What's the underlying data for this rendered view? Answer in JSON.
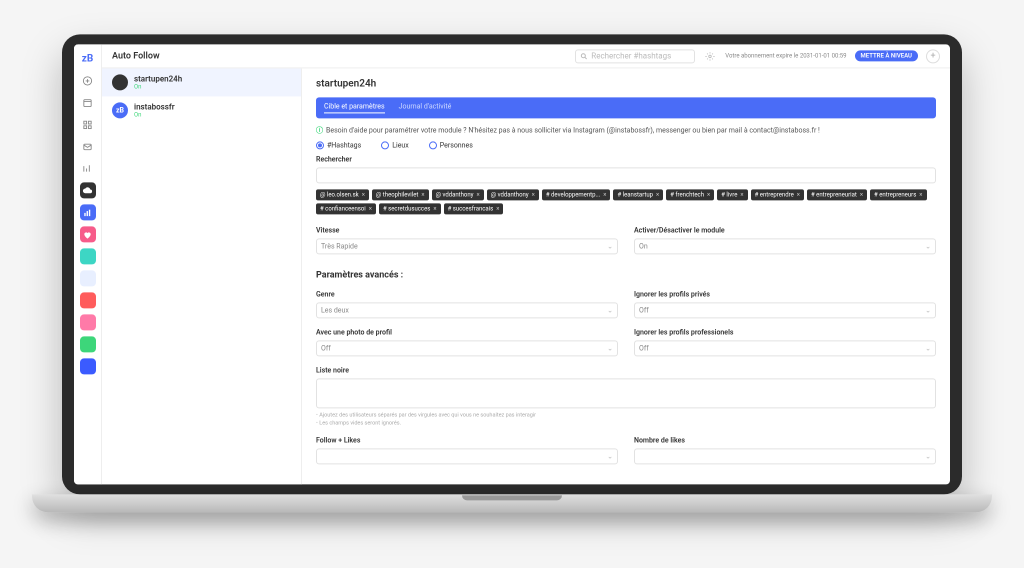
{
  "app": {
    "title": "Auto Follow"
  },
  "topbar": {
    "search_placeholder": "Rechercher #hashtags",
    "expire": "Votre abonnement expire le 2031-01-01 00:59",
    "upgrade": "METTRE À NIVEAU"
  },
  "accounts": [
    {
      "name": "startupen24h",
      "status": "On"
    },
    {
      "name": "instabossfr",
      "status": "On"
    }
  ],
  "panel": {
    "title": "startupen24h",
    "tabs": {
      "targets": "Cible et paramètres",
      "journal": "Journal d'activité"
    },
    "help": "Besoin d'aide pour paramétrer votre module ? N'hésitez pas à nous solliciter via Instagram (@instabossfr), messenger ou bien par mail à contact@instaboss.fr !",
    "radios": {
      "hashtags": "#Hashtags",
      "lieux": "Lieux",
      "personnes": "Personnes"
    },
    "search_label": "Rechercher",
    "tags": [
      "@ leo.olsen.sk",
      "@ theophilevilet",
      "@ vddanthony",
      "@ vddanthony",
      "# developpementp...",
      "# leanstartup",
      "# frenchtech",
      "# livre",
      "# entreprendre",
      "# entrepreneuriat",
      "# entrepreneurs",
      "# confianceensoi",
      "# secretdusucces",
      "# succesfrancais"
    ],
    "vitesse": {
      "label": "Vitesse",
      "value": "Très Rapide"
    },
    "activer": {
      "label": "Activer/Désactiver le module",
      "value": "On"
    },
    "advanced": {
      "heading": "Paramètres avancés :",
      "genre": {
        "label": "Genre",
        "value": "Les deux"
      },
      "ignore_private": {
        "label": "Ignorer les profils privés",
        "value": "Off"
      },
      "photo": {
        "label": "Avec une photo de profil",
        "value": "Off"
      },
      "ignore_pro": {
        "label": "Ignorer les profils professionels",
        "value": "Off"
      },
      "blacklist_label": "Liste noire",
      "hint1": "Ajoutez des utilisateurs séparés par des virgules avec qui vous ne souhaitez pas interagir",
      "hint2": "Les champs vides seront ignorés.",
      "follow_likes": "Follow + Likes",
      "nb_likes": "Nombre de likes"
    }
  }
}
